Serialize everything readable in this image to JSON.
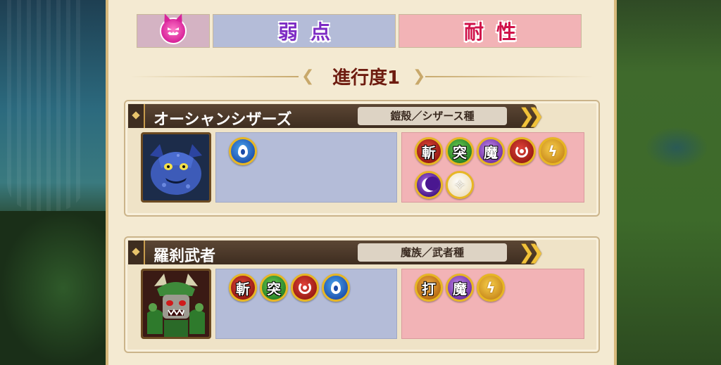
{
  "legend": {
    "enemy_type_icon": "demon-face-icon",
    "weakness_label": "弱点",
    "resistance_label": "耐性"
  },
  "progress": {
    "title": "進行度1"
  },
  "enemies": [
    {
      "name": "オーシャンシザーズ",
      "family": "鎧殻／シザース種",
      "portrait": "blue-crab-monster-portrait",
      "weaknesses": [
        {
          "type": "water",
          "label": ""
        }
      ],
      "resistances": [
        {
          "type": "slash",
          "label": "斬"
        },
        {
          "type": "pierce",
          "label": "突"
        },
        {
          "type": "magic",
          "label": "魔"
        },
        {
          "type": "fire",
          "label": ""
        },
        {
          "type": "thunder",
          "label": ""
        },
        {
          "type": "dark",
          "label": ""
        },
        {
          "type": "light",
          "label": ""
        }
      ]
    },
    {
      "name": "羅刹武者",
      "family": "魔族／武者種",
      "portrait": "green-samurai-demon-portrait",
      "weaknesses": [
        {
          "type": "slash",
          "label": "斬"
        },
        {
          "type": "pierce",
          "label": "突"
        },
        {
          "type": "fire",
          "label": ""
        },
        {
          "type": "water",
          "label": ""
        }
      ],
      "resistances": [
        {
          "type": "blunt",
          "label": "打"
        },
        {
          "type": "magic",
          "label": "魔"
        },
        {
          "type": "thunder",
          "label": ""
        }
      ]
    }
  ]
}
